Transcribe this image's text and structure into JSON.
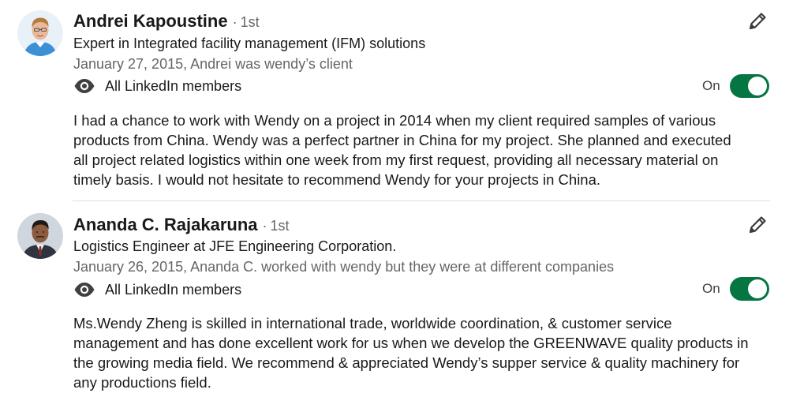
{
  "recommendations": [
    {
      "name": "Andrei Kapoustine",
      "separator": "·",
      "degree": "1st",
      "headline": "Expert in Integrated facility management (IFM) solutions",
      "meta": "January 27, 2015, Andrei was wendy’s client",
      "visibility": "All LinkedIn members",
      "toggle_label": "On",
      "toggle_on": true,
      "text_lines": [
        "I had a chance to work with Wendy on a project in 2014 when my client required samples of various",
        "products from China. Wendy was a perfect partner in China for my project. She planned and executed",
        "all project related logistics within one week from my first request, providing all necessary material on",
        "timely basis. I would not hesitate to recommend Wendy for your projects in China."
      ]
    },
    {
      "name": "Ananda C. Rajakaruna",
      "separator": "·",
      "degree": "1st",
      "headline": "Logistics Engineer at JFE Engineering Corporation.",
      "meta": "January 26, 2015, Ananda C. worked with wendy but they were at different companies",
      "visibility": "All LinkedIn members",
      "toggle_label": "On",
      "toggle_on": true,
      "text_lines": [
        "Ms.Wendy Zheng is skilled in international trade, worldwide coordination, & customer service",
        "management and has done excellent work for us when we develop the GREENWAVE quality products in",
        "the growing media field. We recommend & appreciated Wendy’s supper service & quality machinery for",
        "any productions field."
      ]
    }
  ],
  "icons": {
    "edit": "pencil-icon",
    "visibility": "eye-icon"
  },
  "colors": {
    "toggle_on": "#057642",
    "text_primary": "#191919",
    "text_secondary": "#666666"
  }
}
